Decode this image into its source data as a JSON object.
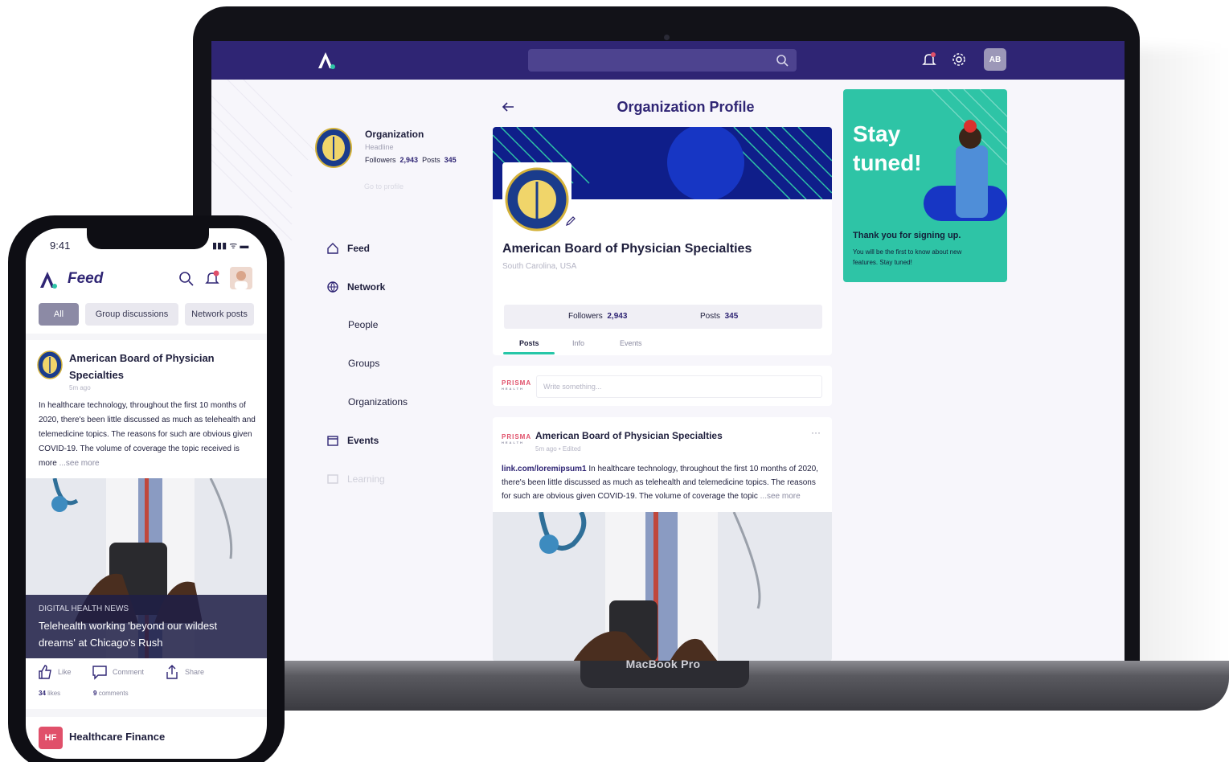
{
  "laptop": {
    "brand_label": "MacBook Pro",
    "topbar": {
      "search_placeholder": "",
      "avatar_initials": "AB"
    },
    "sidebar": {
      "org_name": "Organization",
      "org_headline": "Headline",
      "followers_label": "Followers",
      "followers_value": "2,943",
      "posts_label": "Posts",
      "posts_value": "345",
      "go_profile": "Go to profile",
      "nav": [
        {
          "label": "Feed",
          "icon": "home-icon"
        },
        {
          "label": "Network",
          "icon": "globe-icon"
        },
        {
          "label": "People"
        },
        {
          "label": "Groups"
        },
        {
          "label": "Organizations"
        },
        {
          "label": "Events",
          "icon": "calendar-icon"
        },
        {
          "label": "Learning",
          "icon": "learning-icon"
        }
      ]
    },
    "profile": {
      "title": "Organization Profile",
      "org_full_name": "American Board of Physician Specialties",
      "location": "South Carolina, USA",
      "followers_label": "Followers",
      "followers_value": "2,943",
      "posts_label": "Posts",
      "posts_value": "345",
      "tabs": [
        "Posts",
        "Info",
        "Events"
      ],
      "active_tab": "Posts"
    },
    "compose": {
      "logo_text": "PRISMA",
      "logo_sub": "HEALTH",
      "placeholder": "Write something..."
    },
    "post": {
      "logo_text": "PRISMA",
      "logo_sub": "HEALTH",
      "author": "American Board of Physician Specialties",
      "meta": "5m ago • Edited",
      "more": "···",
      "link": "link.com/loremipsum1",
      "text": " In healthcare technology, throughout the first 10 months of 2020, there's been little discussed as much as telehealth and telemedicine topics. The reasons for such are obvious given COVID-19. The volume of coverage the topic",
      "see_more": "...see more"
    },
    "ad": {
      "title": "Stay tuned!",
      "thanks": "Thank you for signing up.",
      "sub": "You will be the first to know about new features. Stay tuned!"
    }
  },
  "phone": {
    "time": "9:41",
    "status": "▮▮▮ ᯤ ▬",
    "title": "Feed",
    "chips": [
      "All",
      "Group discussions",
      "Network posts"
    ],
    "active_chip": "All",
    "post": {
      "org_name": "American Board of Physician Specialties",
      "time": "5m ago",
      "text": "In healthcare technology, throughout the first 10 months of 2020, there's been little discussed as much as telehealth and telemedicine topics. The reasons for such are obvious given COVID-19. The volume of coverage the topic received is more",
      "see_more": " ...see more",
      "caption_tag": "DIGITAL HEALTH NEWS",
      "caption_title": "Telehealth working 'beyond our wildest dreams' at Chicago's Rush",
      "like": "Like",
      "comment": "Comment",
      "share": "Share",
      "likes_count": "34",
      "likes_label": "likes",
      "comments_count": "9",
      "comments_label": "comments"
    },
    "next_post": {
      "initials": "HF",
      "name": "Healthcare Finance"
    }
  },
  "colors": {
    "brand_navy": "#2f2574",
    "accent_teal": "#2ec4a6",
    "banner_blue": "#0f1e8a",
    "prisma_red": "#e0506a"
  }
}
